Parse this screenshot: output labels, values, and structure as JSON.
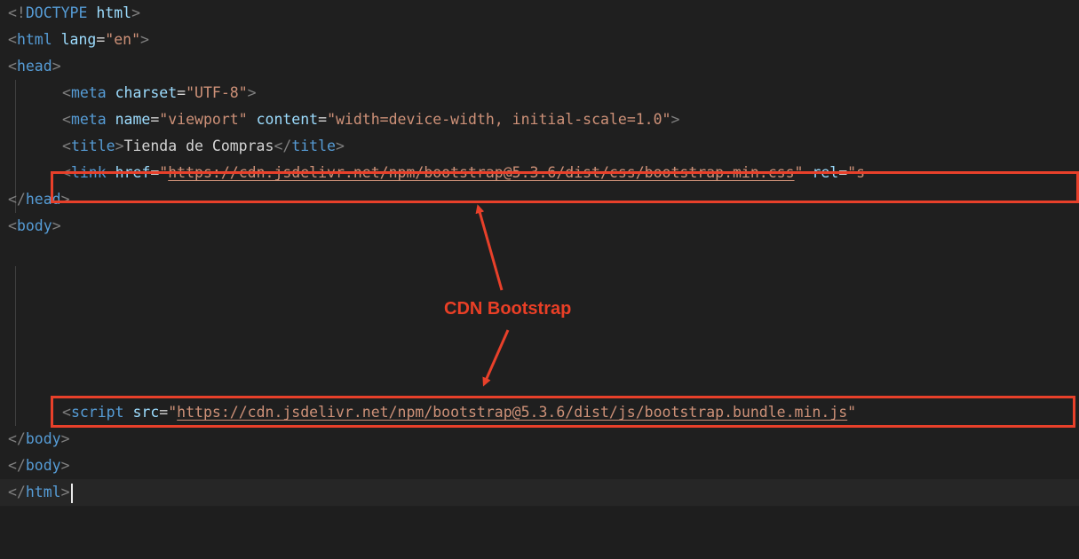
{
  "editor": {
    "lines": {
      "l1": {
        "open": "<!",
        "doctype": "DOCTYPE",
        "html": " html",
        "close": ">"
      },
      "l2": {
        "open": "<",
        "tag": "html",
        "attr": " lang",
        "eq": "=",
        "val": "\"en\"",
        "close": ">"
      },
      "l3": {
        "open": "<",
        "tag": "head",
        "close": ">"
      },
      "l4": {
        "open": "<",
        "tag": "meta",
        "attr": " charset",
        "eq": "=",
        "val": "\"UTF-8\"",
        "close": ">"
      },
      "l5": {
        "open": "<",
        "tag": "meta",
        "attr1": " name",
        "eq1": "=",
        "val1": "\"viewport\"",
        "attr2": " content",
        "eq2": "=",
        "val2": "\"width=device-width, initial-scale=1.0\"",
        "close": ">"
      },
      "l6": {
        "open": "<",
        "tag": "title",
        "close1": ">",
        "text": "Tienda de Compras",
        "open2": "</",
        "tag2": "title",
        "close2": ">"
      },
      "l7": {
        "open": "<",
        "tag": "link",
        "attr": " href",
        "eq": "=",
        "q1": "\"",
        "url": "https://cdn.jsdelivr.net/npm/bootstrap@5.3.6/dist/css/bootstrap.min.css",
        "q2": "\"",
        "attr2": " rel",
        "eq2": "=",
        "q3": "\"s"
      },
      "l8": {
        "open": "</",
        "tag": "head",
        "close": ">"
      },
      "l9": {
        "open": "<",
        "tag": "body",
        "close": ">"
      },
      "l15": {
        "open": "<",
        "tag": "script",
        "attr": " src",
        "eq": "=",
        "q1": "\"",
        "url": "https://cdn.jsdelivr.net/npm/bootstrap@5.3.6/dist/js/bootstrap.bundle.min.js",
        "q2": "\""
      },
      "l16": {
        "open": "</",
        "tag": "body",
        "close": ">"
      },
      "l17": {
        "open": "</",
        "tag": "body",
        "close": ">"
      },
      "l18": {
        "open": "</",
        "tag": "html",
        "close": ">"
      }
    }
  },
  "annotation": {
    "label": "CDN Bootstrap",
    "color": "#e8402a"
  }
}
